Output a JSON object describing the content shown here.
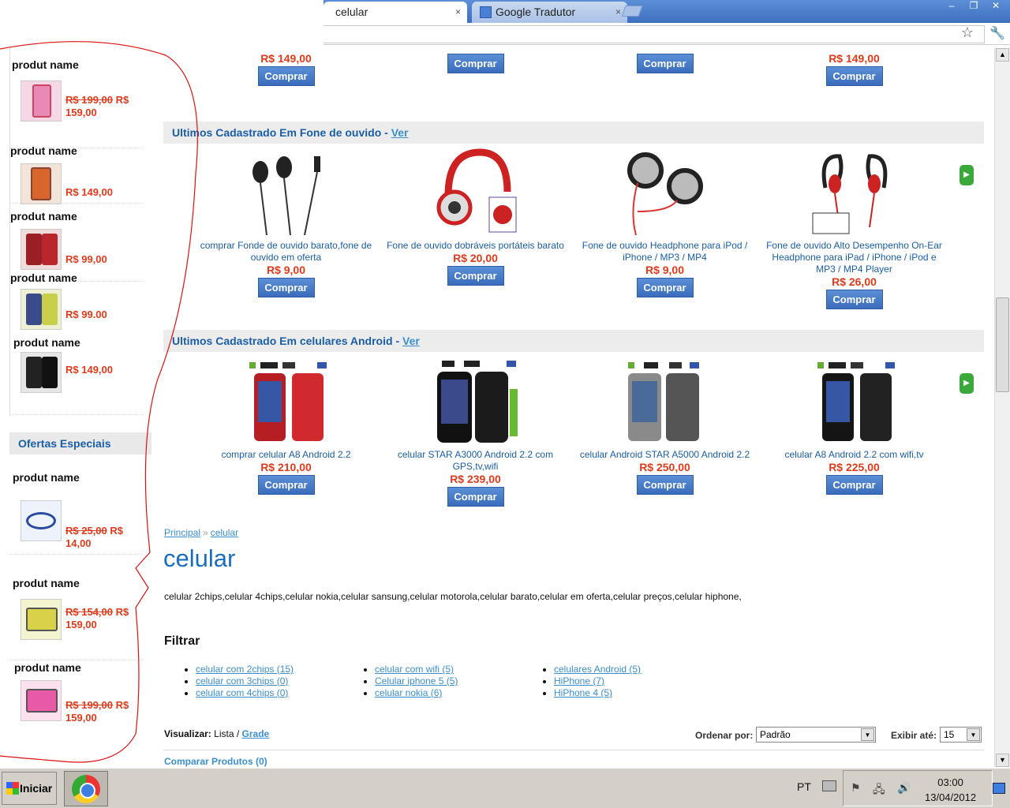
{
  "browser": {
    "tabs": [
      {
        "label": "celular",
        "active": true
      },
      {
        "label": "Google Tradutor",
        "active": false
      }
    ],
    "close_glyph": "×",
    "window_buttons": [
      "–",
      "❐",
      "✕"
    ]
  },
  "sidebar": {
    "items": [
      {
        "name": "produt name",
        "old_price": "R$ 199,00",
        "price": "R$ 159,00",
        "thumb": "pink-phone"
      },
      {
        "name": "produt name",
        "old_price": "",
        "price": "R$ 149,00",
        "thumb": "orange-phone"
      },
      {
        "name": "produt name",
        "old_price": "",
        "price": "R$ 99,00",
        "thumb": "red-phone"
      },
      {
        "name": "produt name",
        "old_price": "",
        "price": "R$ 99.00",
        "thumb": "yellow-phone"
      },
      {
        "name": "produt name",
        "old_price": "",
        "price": "R$ 149,00",
        "thumb": "black-phone"
      }
    ],
    "ofertas_title": "Ofertas Especiais",
    "ofertas": [
      {
        "name": "produt name",
        "old_price": "R$ 25,00",
        "price": "R$ 14,00",
        "thumb": "sport-mp3"
      },
      {
        "name": "produt name",
        "old_price": "R$ 154,00",
        "price": "R$ 159,00",
        "thumb": "yellow-camera"
      },
      {
        "name": "produt name",
        "old_price": "R$ 199,00",
        "price": "R$ 159,00",
        "thumb": "pink-camera"
      }
    ]
  },
  "top_row": [
    {
      "price": "R$ 149,00",
      "button": "Comprar"
    },
    {
      "price": "",
      "button": "Comprar"
    },
    {
      "price": "",
      "button": "Comprar"
    },
    {
      "price": "R$ 149,00",
      "button": "Comprar"
    }
  ],
  "section_fone": {
    "title": "Ultimos Cadastrado Em Fone de ouvido - ",
    "link": "Ver",
    "products": [
      {
        "name": "comprar Fonde de ouvido barato,fone de ouvido em oferta",
        "price": "R$ 9,00",
        "button": "Comprar"
      },
      {
        "name": "Fone de ouvido dobráveis portáteis barato",
        "price": "R$ 20,00",
        "button": "Comprar"
      },
      {
        "name": "Fone de ouvido Headphone para iPod / iPhone / MP3 / MP4",
        "price": "R$ 9,00",
        "button": "Comprar"
      },
      {
        "name": "Fone de ouvido Alto Desempenho On-Ear Headphone para iPad / iPhone / iPod e MP3 / MP4 Player",
        "price": "R$ 26,00",
        "button": "Comprar"
      }
    ]
  },
  "section_android": {
    "title": "Ultimos Cadastrado Em celulares Android - ",
    "link": "Ver",
    "products": [
      {
        "name": "comprar celular A8 Android 2.2",
        "price": "R$ 210,00",
        "button": "Comprar"
      },
      {
        "name": "celular STAR A3000 Android 2.2 com GPS,tv,wifi",
        "price": "R$ 239,00",
        "button": "Comprar"
      },
      {
        "name": "celular Android STAR A5000 Android 2.2",
        "price": "R$ 250,00",
        "button": "Comprar"
      },
      {
        "name": "celular A8 Android 2.2 com wifi,tv",
        "price": "R$ 225,00",
        "button": "Comprar"
      }
    ]
  },
  "breadcrumb": {
    "home": "Principal",
    "sep": "»",
    "current": "celular"
  },
  "page_title": "celular",
  "page_description": "celular 2chips,celular 4chips,celular nokia,celular sansung,celular motorola,celular barato,celular em oferta,celular preços,celular hiphone,",
  "filter": {
    "title": "Filtrar",
    "columns": [
      [
        "celular com 2chips (15)",
        "celular com 3chips (0)",
        "celular com 4chips (0)"
      ],
      [
        "celular com wifi (5)",
        "Celular iphone 5 (5)",
        "celular nokia (6)"
      ],
      [
        "celulares Android (5)",
        "HiPhone (7)",
        "HiPhone 4 (5)"
      ]
    ]
  },
  "view": {
    "label": "Visualizar:",
    "lista": "Lista /",
    "grade": "Grade"
  },
  "sort": {
    "label": "Ordenar por:",
    "value": "Padrão"
  },
  "limit": {
    "label": "Exibir até:",
    "value": "15"
  },
  "compare": "Comparar Produtos (0)",
  "taskbar": {
    "start": "Iniciar",
    "lang": "PT",
    "time": "03:00",
    "date": "13/04/2012"
  },
  "colors": {
    "accent": "#1a5ea8",
    "price": "#e03a1a",
    "button": "#3a6cbc",
    "annotation": "#d11"
  }
}
